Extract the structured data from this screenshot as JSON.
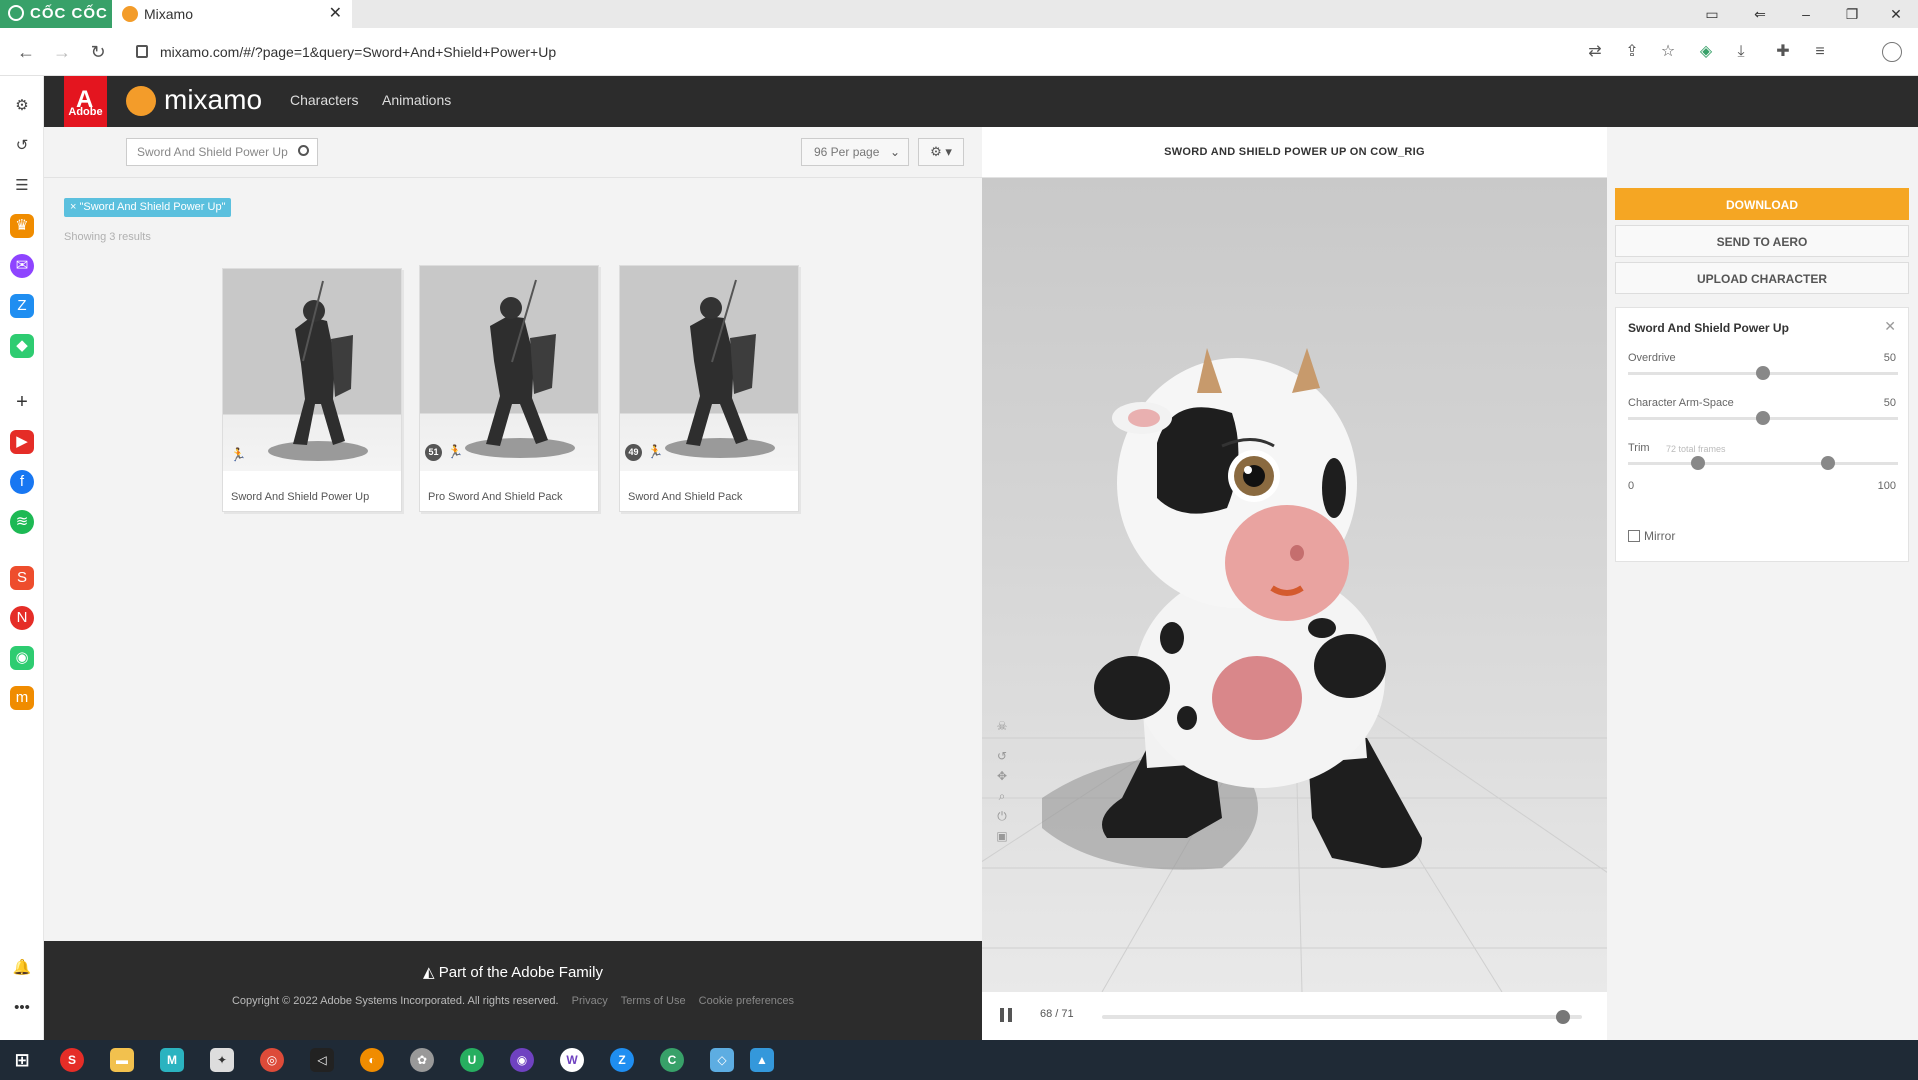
{
  "browser": {
    "brand": "CỐC CỐC",
    "tab_title": "Mixamo",
    "tab_close": "✕",
    "url": "mixamo.com/#/?page=1&query=Sword+And+Shield+Power+Up"
  },
  "mixamo": {
    "adobe_label": "Adobe",
    "logo_text": "mixamo",
    "nav": [
      "Characters",
      "Animations"
    ],
    "search_value": "Sword And Shield Power Up",
    "per_page": "96 Per page",
    "filter_tag": "× \"Sword And Shield Power Up\"",
    "results_text": "Showing 3 results",
    "cards": [
      {
        "label": "Sword And Shield Power Up",
        "badge": ""
      },
      {
        "label": "Pro Sword And Shield Pack",
        "badge": "51"
      },
      {
        "label": "Sword And Shield Pack",
        "badge": "49"
      }
    ],
    "footer": {
      "family": "Part of the Adobe Family",
      "copyright": "Copyright © 2022 Adobe Systems Incorporated. All rights reserved.",
      "links": [
        "Privacy",
        "Terms of Use",
        "Cookie preferences"
      ]
    }
  },
  "viewer": {
    "title": "SWORD AND SHIELD POWER UP ON COW_RIG",
    "frame": "68 / 71",
    "progress_fraction": 0.96
  },
  "panel": {
    "download": "DOWNLOAD",
    "send": "SEND TO AERO",
    "upload": "UPLOAD CHARACTER",
    "title": "Sword And Shield Power Up",
    "overdrive_label": "Overdrive",
    "overdrive_value": "50",
    "armspace_label": "Character Arm-Space",
    "armspace_value": "50",
    "trim_label": "Trim",
    "trim_note": "72 total frames",
    "trim_min": "0",
    "trim_max": "100",
    "mirror_label": "Mirror"
  },
  "colors": {
    "accent": "#f5a623",
    "adobe_red": "#e4151f",
    "header_dark": "#2c2c2c",
    "tag_blue": "#5bc0de"
  }
}
